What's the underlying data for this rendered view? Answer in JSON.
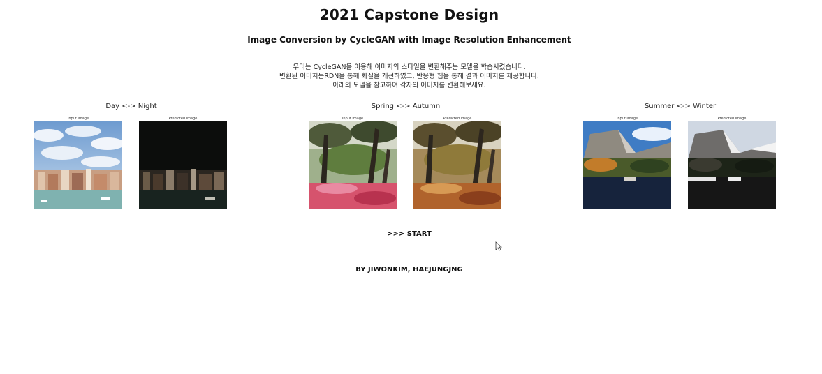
{
  "header": {
    "title": "2021 Capstone Design",
    "subtitle": "Image Conversion by CycleGAN with Image Resolution Enhancement"
  },
  "description": {
    "lines": [
      "우리는 CycleGAN을 이용해 이미지의 스타일을 변환해주는 모델을 학습시켰습니다.",
      "변환된 이미지는RDN을 통해 화질을 개선하였고, 반응형 웹을 통해 결과 이미지를 제공합니다.",
      "아래의 모델을 참고하여 각자의 이미지를 변환해보세요."
    ]
  },
  "examples": [
    {
      "title": "Day <-> Night",
      "input_label": "Input Image",
      "output_label": "Predicted Image"
    },
    {
      "title": "Spring <-> Autumn",
      "input_label": "Input Image",
      "output_label": "Predicted Image"
    },
    {
      "title": "Summer <-> Winter",
      "input_label": "Input Image",
      "output_label": "Predicted Image"
    }
  ],
  "start_link": ">>> START",
  "footer": {
    "authors": "BY JIWONKIM, HAEJUNGJNG"
  },
  "icons": {
    "cursor": "mouse-pointer-icon"
  }
}
